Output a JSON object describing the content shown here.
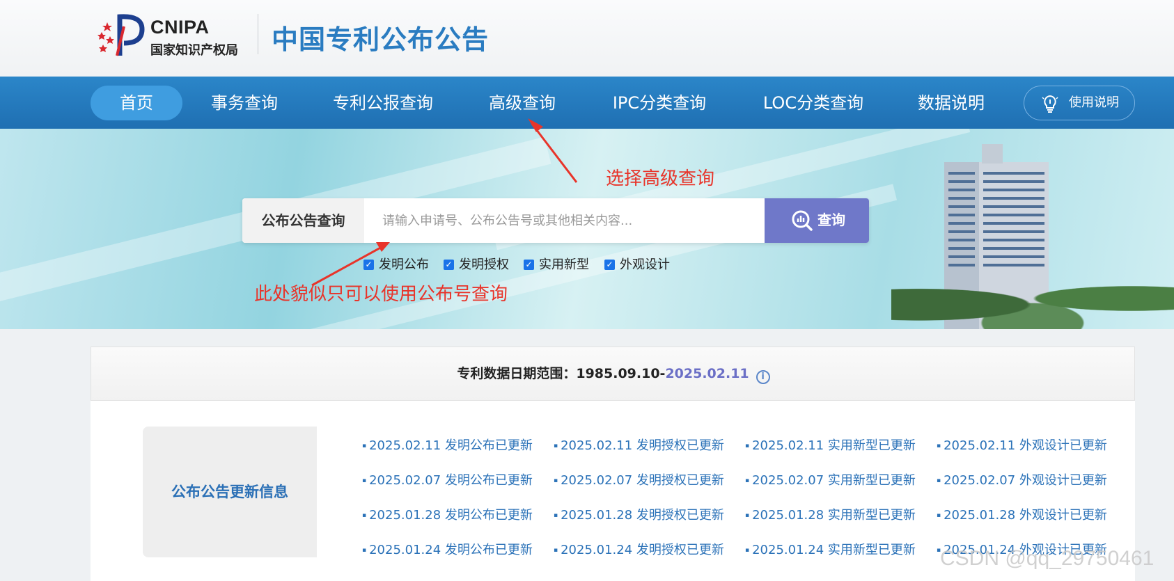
{
  "header": {
    "logo_en": "CNIPA",
    "logo_cn": "国家知识产权局",
    "site_title": "中国专利公布公告"
  },
  "nav": {
    "items": [
      {
        "label": "首页",
        "active": true
      },
      {
        "label": "事务查询"
      },
      {
        "label": "专利公报查询"
      },
      {
        "label": "高级查询"
      },
      {
        "label": "IPC分类查询"
      },
      {
        "label": "LOC分类查询"
      },
      {
        "label": "数据说明"
      }
    ],
    "guide_label": "使用说明"
  },
  "search": {
    "label": "公布公告查询",
    "placeholder": "请输入申请号、公布公告号或其他相关内容...",
    "button_label": "查询",
    "filters": [
      {
        "label": "发明公布",
        "checked": true
      },
      {
        "label": "发明授权",
        "checked": true
      },
      {
        "label": "实用新型",
        "checked": true
      },
      {
        "label": "外观设计",
        "checked": true
      }
    ]
  },
  "annotations": {
    "advanced_note": "选择高级查询",
    "search_note": "此处貌似只可以使用公布号查询"
  },
  "date_range": {
    "label": "专利数据日期范围：",
    "start": "1985.09.10-",
    "end": "2025.02.11"
  },
  "updates": {
    "title": "公布公告更新信息",
    "rows": [
      [
        "2025.02.11 发明公布已更新",
        "2025.02.11 发明授权已更新",
        "2025.02.11 实用新型已更新",
        "2025.02.11 外观设计已更新"
      ],
      [
        "2025.02.07 发明公布已更新",
        "2025.02.07 发明授权已更新",
        "2025.02.07 实用新型已更新",
        "2025.02.07 外观设计已更新"
      ],
      [
        "2025.01.28 发明公布已更新",
        "2025.01.28 发明授权已更新",
        "2025.01.28 实用新型已更新",
        "2025.01.28 外观设计已更新"
      ],
      [
        "2025.01.24 发明公布已更新",
        "2025.01.24 发明授权已更新",
        "2025.01.24 实用新型已更新",
        "2025.01.24 外观设计已更新"
      ]
    ]
  },
  "watermark": "CSDN @qq_29750461",
  "colors": {
    "nav_bg": "#2177bb",
    "nav_active": "#3f9de0",
    "search_button": "#6f78c9",
    "annotation": "#e8342a",
    "link": "#2b72b8"
  }
}
